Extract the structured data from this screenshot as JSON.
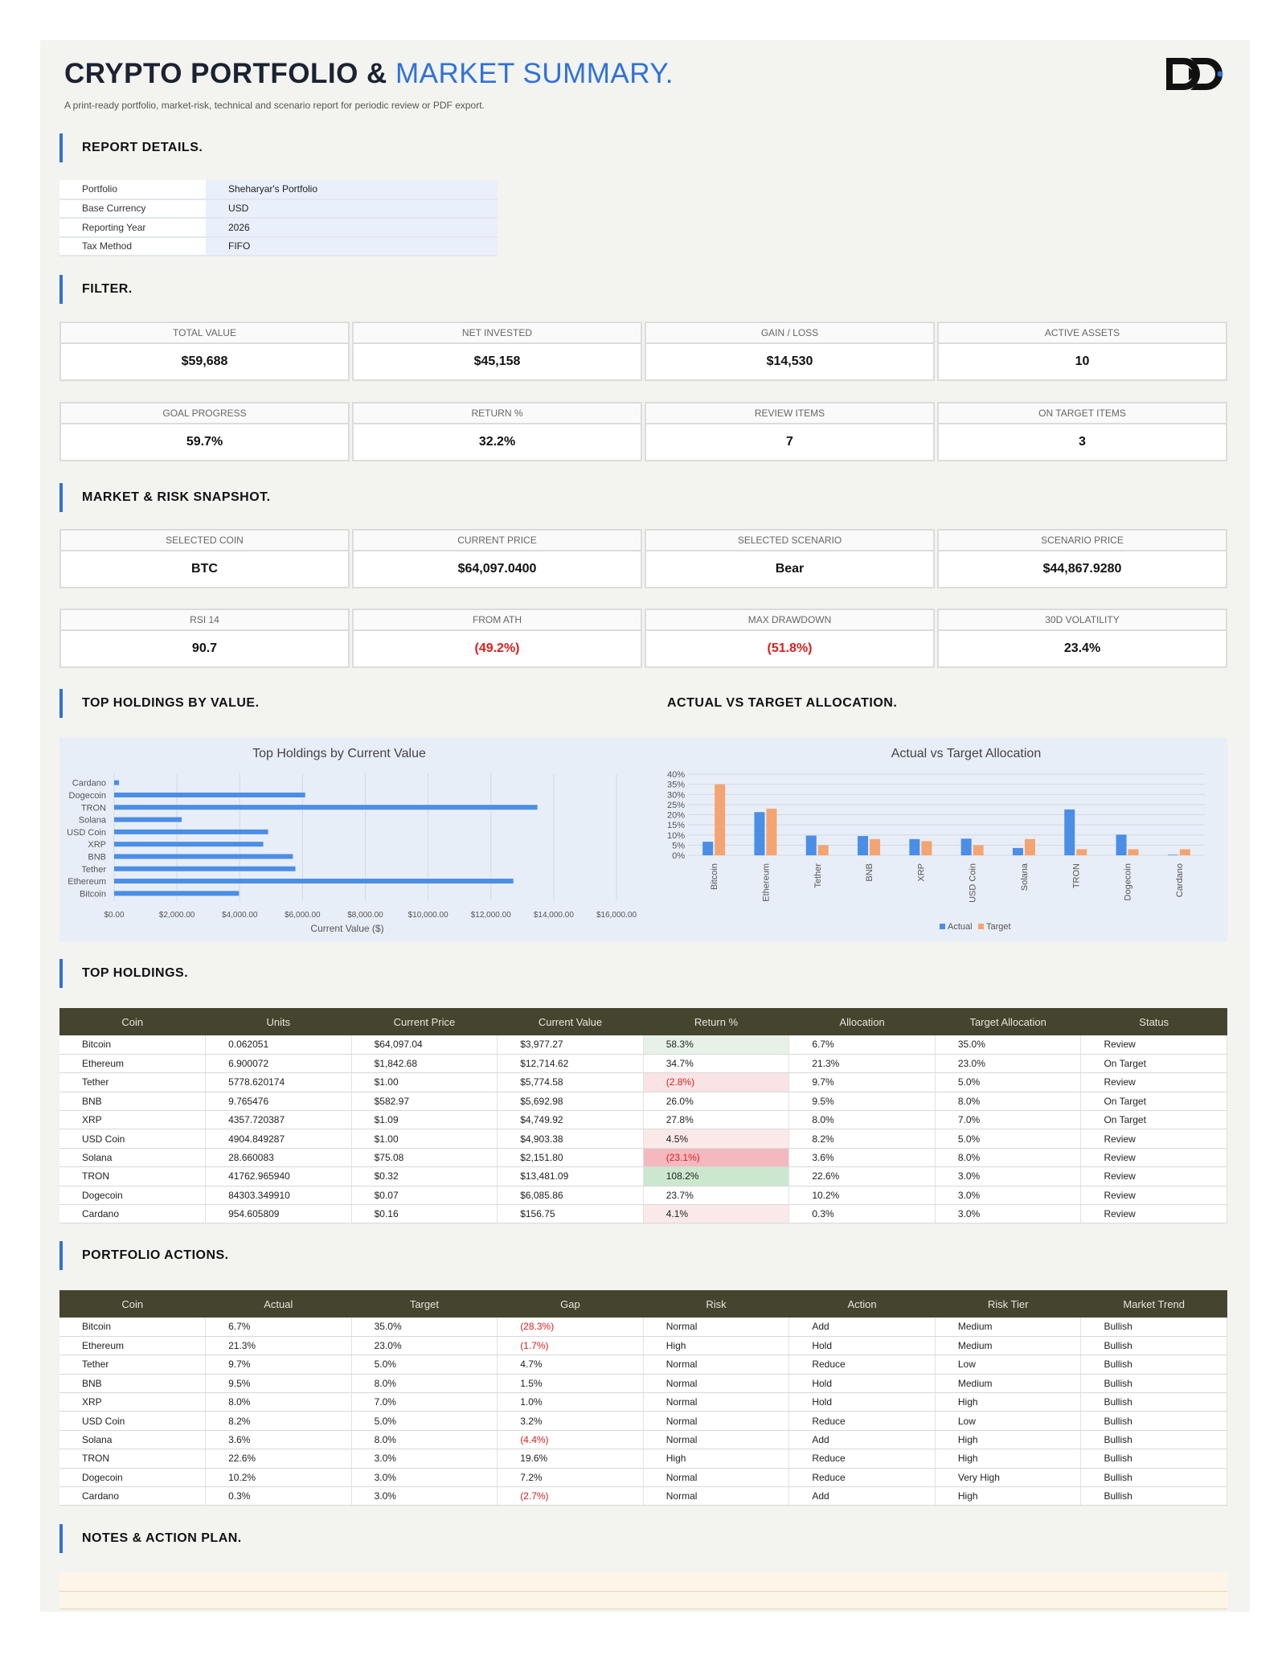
{
  "header": {
    "title_dark": "CRYPTO PORTFOLIO &",
    "title_blue": "MARKET SUMMARY.",
    "subtitle": "A print-ready portfolio, market-risk, technical and scenario report for periodic review or PDF export."
  },
  "sections": {
    "report_details": "REPORT DETAILS.",
    "filter": "FILTER.",
    "market_risk": "MARKET & RISK SNAPSHOT.",
    "top_holdings_value": "TOP HOLDINGS BY VALUE.",
    "actual_vs_target": "ACTUAL VS TARGET ALLOCATION.",
    "top_holdings": "TOP HOLDINGS.",
    "portfolio_actions": "PORTFOLIO ACTIONS.",
    "notes": "NOTES & ACTION PLAN."
  },
  "report_details": [
    {
      "key": "Portfolio",
      "value": "Sheharyar's Portfolio"
    },
    {
      "key": "Base Currency",
      "value": "USD"
    },
    {
      "key": "Reporting Year",
      "value": "2026"
    },
    {
      "key": "Tax Method",
      "value": "FIFO"
    }
  ],
  "kpis_row1": [
    {
      "label": "TOTAL VALUE",
      "value": "$59,688"
    },
    {
      "label": "NET INVESTED",
      "value": "$45,158"
    },
    {
      "label": "GAIN / LOSS",
      "value": "$14,530"
    },
    {
      "label": "ACTIVE ASSETS",
      "value": "10"
    }
  ],
  "kpis_row2": [
    {
      "label": "GOAL PROGRESS",
      "value": "59.7%"
    },
    {
      "label": "RETURN %",
      "value": "32.2%"
    },
    {
      "label": "REVIEW ITEMS",
      "value": "7"
    },
    {
      "label": "ON TARGET ITEMS",
      "value": "3"
    }
  ],
  "market_row1": [
    {
      "label": "SELECTED COIN",
      "value": "BTC"
    },
    {
      "label": "CURRENT PRICE",
      "value": "$64,097.0400"
    },
    {
      "label": "SELECTED SCENARIO",
      "value": "Bear"
    },
    {
      "label": "SCENARIO PRICE",
      "value": "$44,867.9280"
    }
  ],
  "market_row2": [
    {
      "label": "RSI 14",
      "value": "90.7"
    },
    {
      "label": "FROM ATH",
      "value": "(49.2%)"
    },
    {
      "label": "MAX DRAWDOWN",
      "value": "(51.8%)"
    },
    {
      "label": "30D VOLATILITY",
      "value": "23.4%"
    }
  ],
  "colors": {
    "accent": "#2f72d9",
    "header_dark": "#45442f",
    "actual": "#4a8ee6",
    "target": "#f4a470",
    "negative": "#d92020"
  },
  "chart_data": [
    {
      "type": "bar",
      "orientation": "horizontal",
      "title": "Top Holdings by Current Value",
      "xlabel": "Current Value ($)",
      "ylabel": "",
      "categories": [
        "Bitcoin",
        "Ethereum",
        "Tether",
        "BNB",
        "XRP",
        "USD Coin",
        "Solana",
        "TRON",
        "Dogecoin",
        "Cardano"
      ],
      "values": [
        3977.27,
        12714.62,
        5774.58,
        5692.98,
        4749.92,
        4903.38,
        2151.8,
        13481.09,
        6085.86,
        156.75
      ],
      "xlim": [
        0,
        16000
      ],
      "xticks": [
        "$0.00",
        "$2,000.00",
        "$4,000.00",
        "$6,000.00",
        "$8,000.00",
        "$10,000.00",
        "$12,000.00",
        "$14,000.00",
        "$16,000.00"
      ],
      "grid": true
    },
    {
      "type": "bar",
      "title": "Actual vs Target Allocation",
      "xlabel": "",
      "ylabel": "",
      "categories": [
        "Bitcoin",
        "Ethereum",
        "Tether",
        "BNB",
        "XRP",
        "USD Coin",
        "Solana",
        "TRON",
        "Dogecoin",
        "Cardano"
      ],
      "series": [
        {
          "name": "Actual",
          "values": [
            6.7,
            21.3,
            9.7,
            9.5,
            8.0,
            8.2,
            3.6,
            22.6,
            10.2,
            0.3
          ]
        },
        {
          "name": "Target",
          "values": [
            35.0,
            23.0,
            5.0,
            8.0,
            7.0,
            5.0,
            8.0,
            3.0,
            3.0,
            3.0
          ]
        }
      ],
      "ylim": [
        0,
        40
      ],
      "yticks": [
        "0%",
        "5%",
        "10%",
        "15%",
        "20%",
        "25%",
        "30%",
        "35%",
        "40%"
      ],
      "legend": "bottom",
      "grid": true
    }
  ],
  "holdings": {
    "headers": [
      "Coin",
      "Units",
      "Current Price",
      "Current Value",
      "Return %",
      "Allocation",
      "Target Allocation",
      "Status"
    ],
    "rows": [
      {
        "coin": "Bitcoin",
        "units": "0.062051",
        "price": "$64,097.04",
        "value": "$3,977.27",
        "ret": "58.3%",
        "alloc": "6.7%",
        "target": "35.0%",
        "status": "Review"
      },
      {
        "coin": "Ethereum",
        "units": "6.900072",
        "price": "$1,842.68",
        "value": "$12,714.62",
        "ret": "34.7%",
        "alloc": "21.3%",
        "target": "23.0%",
        "status": "On Target"
      },
      {
        "coin": "Tether",
        "units": "5778.620174",
        "price": "$1.00",
        "value": "$5,774.58",
        "ret": "(2.8%)",
        "alloc": "9.7%",
        "target": "5.0%",
        "status": "Review"
      },
      {
        "coin": "BNB",
        "units": "9.765476",
        "price": "$582.97",
        "value": "$5,692.98",
        "ret": "26.0%",
        "alloc": "9.5%",
        "target": "8.0%",
        "status": "On Target"
      },
      {
        "coin": "XRP",
        "units": "4357.720387",
        "price": "$1.09",
        "value": "$4,749.92",
        "ret": "27.8%",
        "alloc": "8.0%",
        "target": "7.0%",
        "status": "On Target"
      },
      {
        "coin": "USD Coin",
        "units": "4904.849287",
        "price": "$1.00",
        "value": "$4,903.38",
        "ret": "4.5%",
        "alloc": "8.2%",
        "target": "5.0%",
        "status": "Review"
      },
      {
        "coin": "Solana",
        "units": "28.660083",
        "price": "$75.08",
        "value": "$2,151.80",
        "ret": "(23.1%)",
        "alloc": "3.6%",
        "target": "8.0%",
        "status": "Review"
      },
      {
        "coin": "TRON",
        "units": "41762.965940",
        "price": "$0.32",
        "value": "$13,481.09",
        "ret": "108.2%",
        "alloc": "22.6%",
        "target": "3.0%",
        "status": "Review"
      },
      {
        "coin": "Dogecoin",
        "units": "84303.349910",
        "price": "$0.07",
        "value": "$6,085.86",
        "ret": "23.7%",
        "alloc": "10.2%",
        "target": "3.0%",
        "status": "Review"
      },
      {
        "coin": "Cardano",
        "units": "954.605809",
        "price": "$0.16",
        "value": "$156.75",
        "ret": "4.1%",
        "alloc": "0.3%",
        "target": "3.0%",
        "status": "Review"
      }
    ]
  },
  "actions": {
    "headers": [
      "Coin",
      "Actual",
      "Target",
      "Gap",
      "Risk",
      "Action",
      "Risk Tier",
      "Market Trend"
    ],
    "rows": [
      {
        "coin": "Bitcoin",
        "actual": "6.7%",
        "target": "35.0%",
        "gap": "(28.3%)",
        "risk": "Normal",
        "action": "Add",
        "tier": "Medium",
        "trend": "Bullish"
      },
      {
        "coin": "Ethereum",
        "actual": "21.3%",
        "target": "23.0%",
        "gap": "(1.7%)",
        "risk": "High",
        "action": "Hold",
        "tier": "Medium",
        "trend": "Bullish"
      },
      {
        "coin": "Tether",
        "actual": "9.7%",
        "target": "5.0%",
        "gap": "4.7%",
        "risk": "Normal",
        "action": "Reduce",
        "tier": "Low",
        "trend": "Bullish"
      },
      {
        "coin": "BNB",
        "actual": "9.5%",
        "target": "8.0%",
        "gap": "1.5%",
        "risk": "Normal",
        "action": "Hold",
        "tier": "Medium",
        "trend": "Bullish"
      },
      {
        "coin": "XRP",
        "actual": "8.0%",
        "target": "7.0%",
        "gap": "1.0%",
        "risk": "Normal",
        "action": "Hold",
        "tier": "High",
        "trend": "Bullish"
      },
      {
        "coin": "USD Coin",
        "actual": "8.2%",
        "target": "5.0%",
        "gap": "3.2%",
        "risk": "Normal",
        "action": "Reduce",
        "tier": "Low",
        "trend": "Bullish"
      },
      {
        "coin": "Solana",
        "actual": "3.6%",
        "target": "8.0%",
        "gap": "(4.4%)",
        "risk": "Normal",
        "action": "Add",
        "tier": "High",
        "trend": "Bullish"
      },
      {
        "coin": "TRON",
        "actual": "22.6%",
        "target": "3.0%",
        "gap": "19.6%",
        "risk": "High",
        "action": "Reduce",
        "tier": "High",
        "trend": "Bullish"
      },
      {
        "coin": "Dogecoin",
        "actual": "10.2%",
        "target": "3.0%",
        "gap": "7.2%",
        "risk": "Normal",
        "action": "Reduce",
        "tier": "Very High",
        "trend": "Bullish"
      },
      {
        "coin": "Cardano",
        "actual": "0.3%",
        "target": "3.0%",
        "gap": "(2.7%)",
        "risk": "Normal",
        "action": "Add",
        "tier": "High",
        "trend": "Bullish"
      }
    ]
  }
}
